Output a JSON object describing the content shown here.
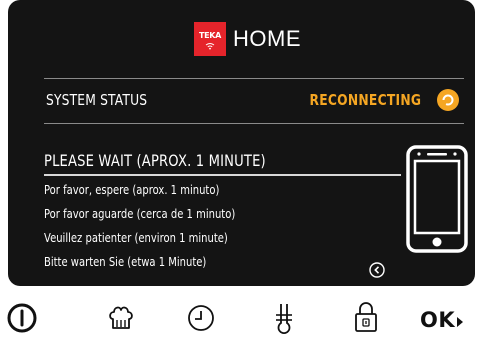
{
  "header": {
    "logo_text": "TEKA",
    "title": "HOME"
  },
  "system_status": {
    "label": "SYSTEM STATUS",
    "value": "RECONNECTING",
    "status_color": "#f5a623"
  },
  "wait_message": {
    "title": "PLEASE WAIT (APROX. 1 MINUTE)",
    "lines": [
      "Por favor, espere (aprox. 1 minuto)",
      "Por favor aguarde (cerca de 1 minuto)",
      "Veuillez patienter (environ 1 minute)",
      "Bitte warten Sie (etwa 1 Minute)"
    ]
  },
  "icons": {
    "status": "refresh-icon",
    "device": "smartphone-icon",
    "back": "chevron-left-circle-icon"
  },
  "bottom_bar": {
    "buttons": [
      {
        "name": "power-icon"
      },
      {
        "name": "chef-hat-icon"
      },
      {
        "name": "clock-icon"
      },
      {
        "name": "thermometer-icon"
      },
      {
        "name": "lock-icon"
      }
    ],
    "ok_label": "OK"
  }
}
